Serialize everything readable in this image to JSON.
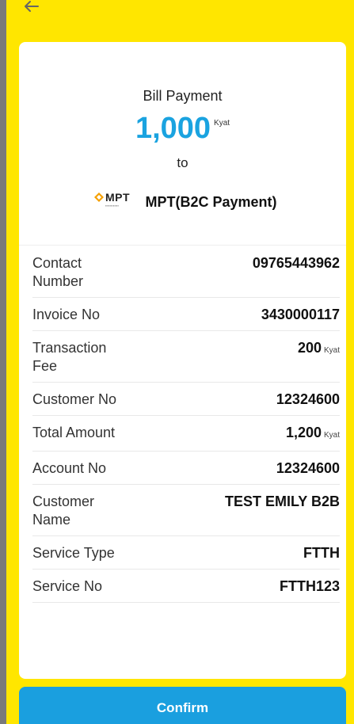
{
  "header": {
    "back_icon": "arrow-left-icon"
  },
  "summary": {
    "title": "Bill Payment",
    "amount": "1,000",
    "amount_unit": "Kyat",
    "to_label": "to",
    "biller_logo_text": "MPT",
    "biller_name": "MPT(B2C Payment)"
  },
  "details": [
    {
      "label": "Contact Number",
      "value": "09765443962",
      "unit": ""
    },
    {
      "label": "Invoice No",
      "value": "3430000117",
      "unit": ""
    },
    {
      "label": "Transaction Fee",
      "value": "200",
      "unit": "Kyat"
    },
    {
      "label": "Customer No",
      "value": "12324600",
      "unit": ""
    },
    {
      "label": "Total Amount",
      "value": "1,200",
      "unit": "Kyat"
    },
    {
      "label": "Account No",
      "value": "12324600",
      "unit": ""
    },
    {
      "label": "Customer Name",
      "value": "TEST EMILY B2B",
      "unit": ""
    },
    {
      "label": "Service Type",
      "value": "FTTH",
      "unit": ""
    },
    {
      "label": "Service No",
      "value": "FTTH123",
      "unit": ""
    }
  ],
  "confirm_label": "Confirm",
  "colors": {
    "background": "#ffe600",
    "accent": "#1a9fdf"
  }
}
